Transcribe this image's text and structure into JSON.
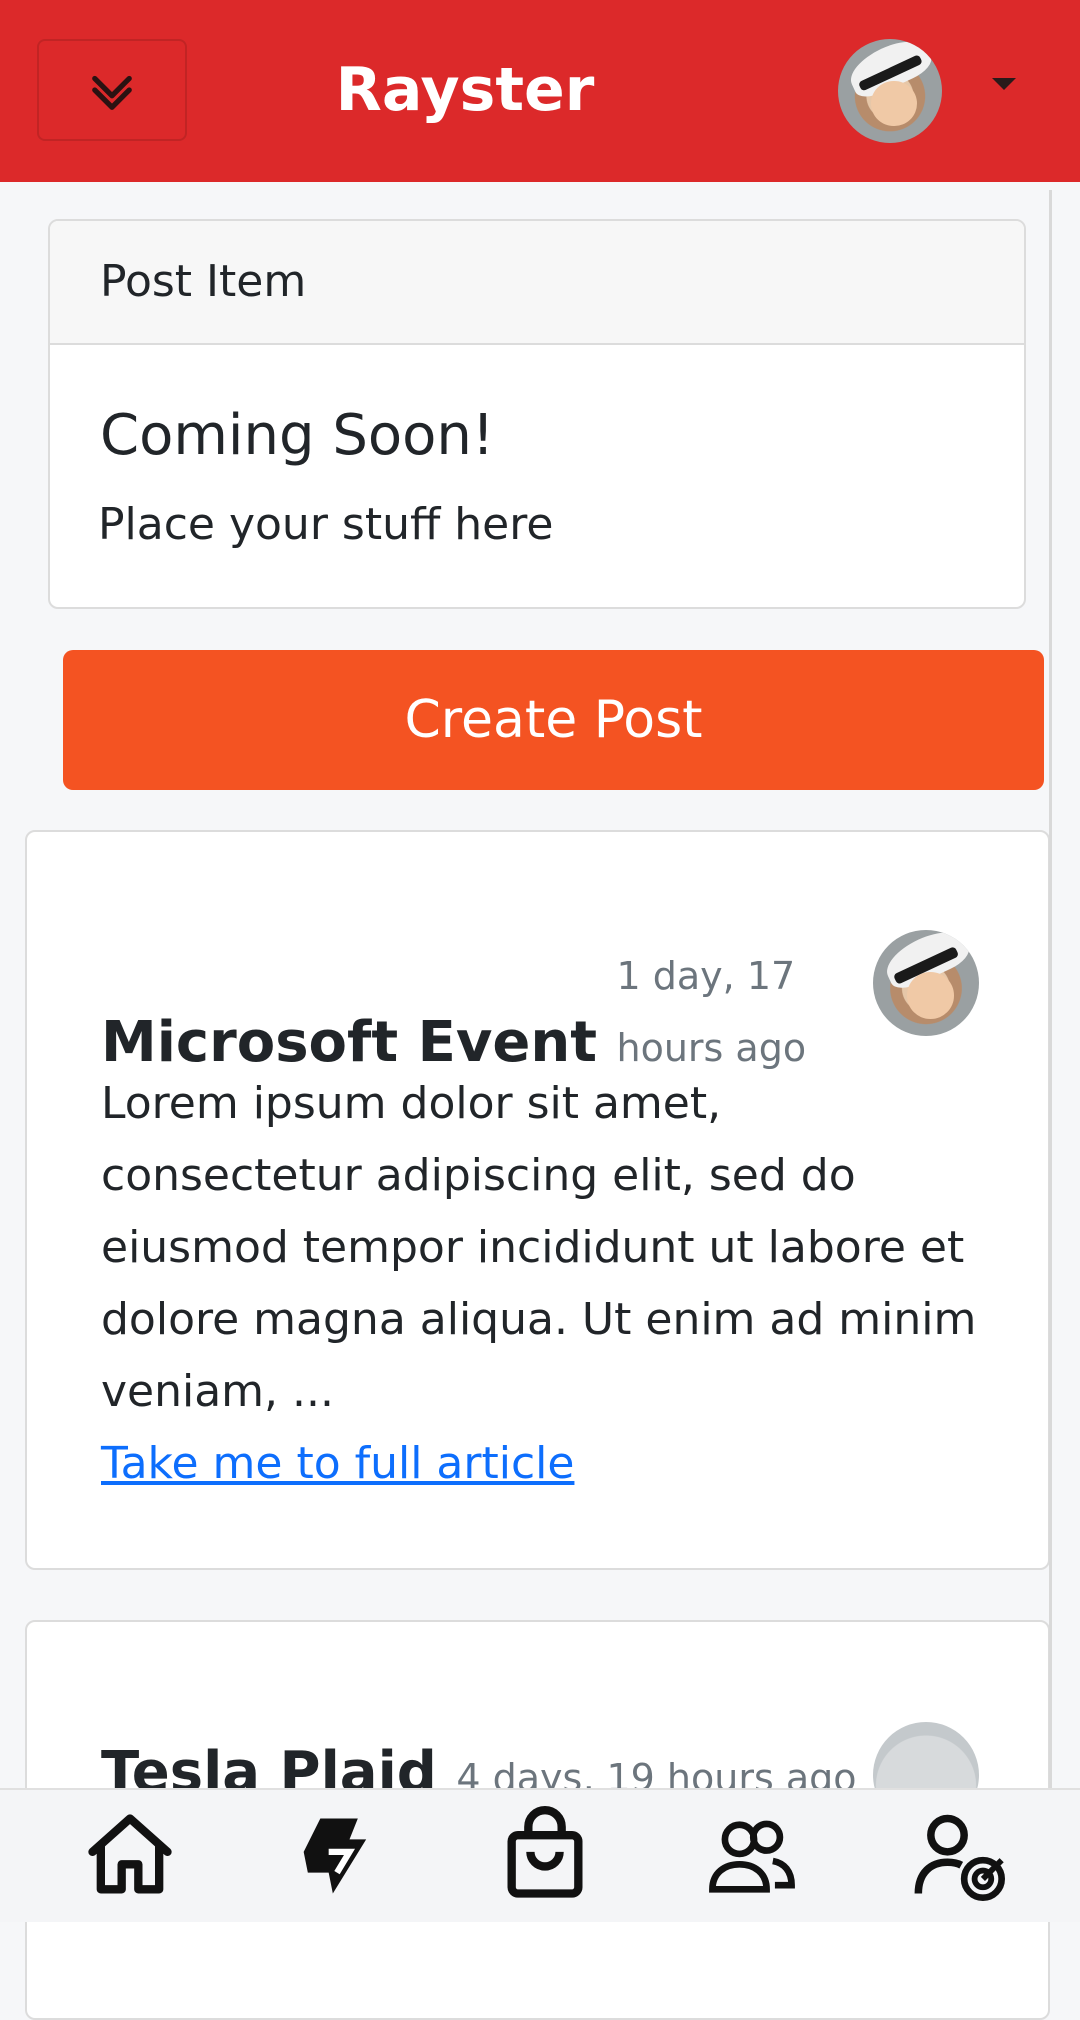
{
  "header": {
    "brand": "Rayster",
    "toggle_icon": "chevron-double-down-icon",
    "profile_caret_icon": "caret-down-icon",
    "background_color": "#dc292a"
  },
  "post_item_card": {
    "header_label": "Post Item",
    "title": "Coming Soon!",
    "text": "Place your stuff here"
  },
  "create_post": {
    "label": "Create Post",
    "color": "#f45322"
  },
  "articles": [
    {
      "title": "Microsoft Event",
      "time": "1 day, 17 hours ago",
      "excerpt": "Lorem ipsum dolor sit amet, consectetur adipiscing elit, sed do eiusmod tempor incididunt ut labore et dolore magna aliqua. Ut enim ad minim veniam, ...",
      "link_label": "Take me to full article"
    },
    {
      "title": "Tesla Plaid",
      "time": "4 days, 19 hours ago"
    }
  ],
  "bottom_nav": {
    "items": [
      "home-icon",
      "app-logo-icon",
      "shop-bag-icon",
      "people-icon",
      "user-target-icon"
    ]
  }
}
